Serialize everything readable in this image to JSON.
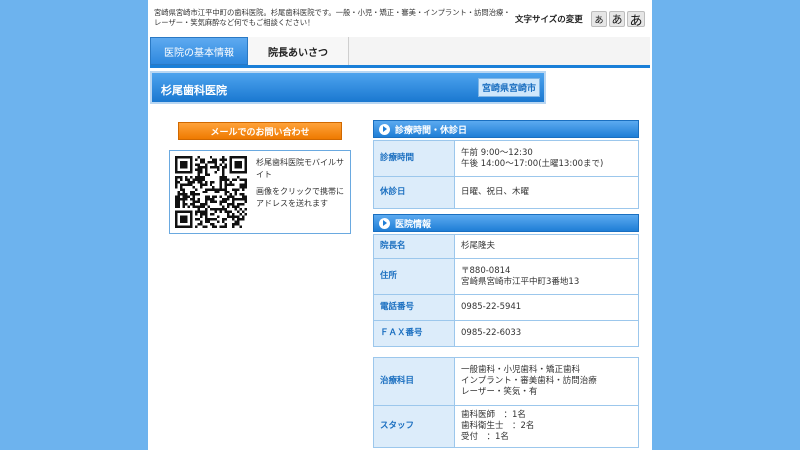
{
  "header": {
    "description": "宮崎県宮崎市江平中町の歯科医院。杉尾歯科医院です。一般・小児・矯正・審美・インプラント・訪問治療・レーザー・笑気麻酔など何でもご相談ください！",
    "font_size_label": "文字サイズの変更",
    "font_size_buttons": [
      "あ",
      "あ",
      "あ"
    ]
  },
  "tabs": [
    {
      "label": "医院の基本情報",
      "active": true
    },
    {
      "label": "院長あいさつ",
      "active": false
    }
  ],
  "banner": {
    "title": "杉尾歯科医院",
    "location": "宮崎県宮崎市"
  },
  "contact": {
    "mail_button": "メールでのお問い合わせ",
    "qr_title": "杉尾歯科医院モバイルサイト",
    "qr_desc": "画像をクリックで携帯にアドレスを送れます"
  },
  "hours": {
    "title": "診療時間・休診日",
    "rows": [
      {
        "label": "診療時間",
        "lines": [
          "午前 9:00～12:30",
          "午後 14:00～17:00(土曜13:00まで)"
        ]
      },
      {
        "label": "休診日",
        "lines": [
          "日曜、祝日、木曜"
        ]
      }
    ]
  },
  "clinic": {
    "title": "医院情報",
    "rows": [
      {
        "label": "院長名",
        "lines": [
          "杉尾隆夫"
        ]
      },
      {
        "label": "住所",
        "lines": [
          "〒880-0814",
          "宮崎県宮崎市江平中町3番地13"
        ]
      },
      {
        "label": "電話番号",
        "lines": [
          "0985-22-5941"
        ]
      },
      {
        "label": "ＦＡＸ番号",
        "lines": [
          "0985-22-6033"
        ]
      }
    ]
  },
  "treatment": {
    "rows": [
      {
        "label": "治療科目",
        "lines": [
          "一般歯科・小児歯科・矯正歯科",
          "インプラント・審美歯科・訪問治療",
          "レーザー・笑気・有"
        ]
      },
      {
        "label": "スタッフ",
        "lines": [
          "歯科医師　：1名",
          "歯科衛生士　：2名",
          "受付　：1名"
        ]
      }
    ]
  },
  "colors": {
    "background": "#6db3ee",
    "accent": "#1f7ed6",
    "mail_button": "#ef7a00"
  }
}
